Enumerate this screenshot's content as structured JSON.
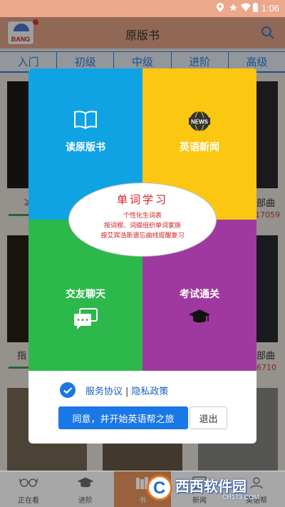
{
  "status_bar": {
    "time": "1:06"
  },
  "header": {
    "title": "原版书",
    "logo_text": "BANG"
  },
  "tabs": [
    {
      "label": "入门"
    },
    {
      "label": "初级"
    },
    {
      "label": "中级"
    },
    {
      "label": "进阶"
    },
    {
      "label": "高级"
    }
  ],
  "background_books": {
    "row1_left_label": "冰",
    "row1_right_label": "部曲",
    "row1_right_count": "17059",
    "row2_left_label": "指",
    "row2_right_label": "部曲",
    "row2_right_count": "6710"
  },
  "dialog": {
    "quadrants": [
      {
        "label": "读原版书",
        "icon": "book-icon",
        "color": "#0fa3e4"
      },
      {
        "label": "英语新闻",
        "icon": "news-globe-icon",
        "icon_text": "NEWS",
        "color": "#fbc711"
      },
      {
        "label": "交友聊天",
        "icon": "chat-bubbles-icon",
        "color": "#2db84c"
      },
      {
        "label": "考试通关",
        "icon": "graduation-cap-icon",
        "color": "#a0399f"
      }
    ],
    "center": {
      "title": "单词学习",
      "lines": [
        "个性化生词表",
        "按词根、词缀组织单词家族",
        "按艾宾浩斯遗忘曲线提醒复习"
      ]
    },
    "agreement": {
      "checked": true,
      "service_link": "服务协议",
      "separator": "|",
      "privacy_link": "隐私政策"
    },
    "agree_button": "同意，并开始英语帮之旅",
    "exit_button": "退出"
  },
  "bottom_nav": [
    {
      "label": "正在看",
      "icon": "glasses-icon"
    },
    {
      "label": "进阶",
      "icon": "graduation-cap-icon"
    },
    {
      "label": "书",
      "icon": "books-icon",
      "active": true
    },
    {
      "label": "新闻",
      "icon": "news-icon"
    },
    {
      "label": "英语帮",
      "icon": "user-icon"
    }
  ],
  "watermark": {
    "main": "西西软件园",
    "sub": "CR173.COM"
  }
}
